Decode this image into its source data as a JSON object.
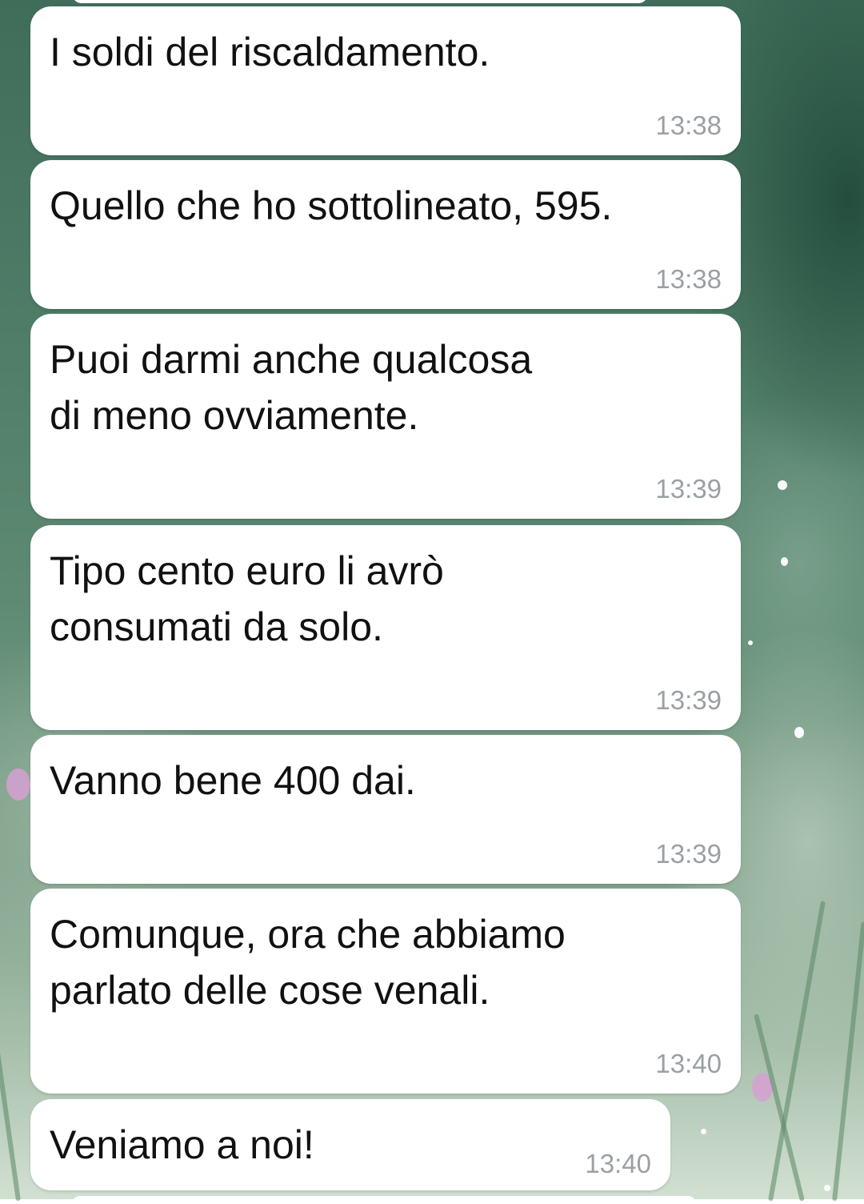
{
  "messages": [
    {
      "text": "I soldi del riscaldamento.",
      "time": "13:38"
    },
    {
      "text": "Quello che ho sottolineato, 595.",
      "time": "13:38"
    },
    {
      "text": "Puoi darmi anche qualcosa\ndi meno ovviamente.",
      "time": "13:39"
    },
    {
      "text": "Tipo cento euro li avrò\nconsumati da solo.",
      "time": "13:39"
    },
    {
      "text": "Vanno bene 400 dai.",
      "time": "13:39"
    },
    {
      "text": "Comunque, ora che abbiamo\nparlato delle cose venali.",
      "time": "13:40"
    },
    {
      "text": "Veniamo a noi!",
      "time": "13:40"
    }
  ],
  "colors": {
    "bubble": "#ffffff",
    "message_text": "#111111",
    "timestamp": "#9aa0a3",
    "wallpaper_base": "#4d7b66"
  }
}
